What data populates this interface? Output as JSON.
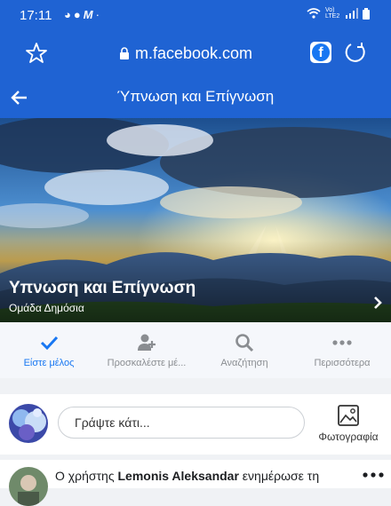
{
  "status_bar": {
    "time": "17:11",
    "notification_icons": [
      "messenger-icon",
      "facebook-icon",
      "m-app-icon",
      "dot-icon"
    ],
    "right_icons": [
      "wifi-icon",
      "volte-lte2-icon",
      "signal-icon",
      "battery-icon"
    ],
    "network_label": "Vo) LTE2"
  },
  "browser": {
    "url": "m.facebook.com",
    "fb_badge": "f"
  },
  "header": {
    "title": "Ύπνωση και Επίγνωση"
  },
  "cover": {
    "group_name": "Υπνωση και Επίγνωση",
    "group_type": "Ομάδα Δημόσια"
  },
  "actions": [
    {
      "label": "Είστε μέλος",
      "icon": "check-icon",
      "active": true
    },
    {
      "label": "Προσκαλέστε μέ...",
      "icon": "add-person-icon",
      "active": false
    },
    {
      "label": "Αναζήτηση",
      "icon": "search-icon",
      "active": false
    },
    {
      "label": "Περισσότερα",
      "icon": "more-dots-icon",
      "active": false
    }
  ],
  "composer": {
    "placeholder": "Γράψτε κάτι...",
    "photo_label": "Φωτογραφία"
  },
  "post": {
    "prefix": "Ο χρήστης ",
    "author": "Lemonis Aleksandar",
    "action_text": " ενημέρωσε τη"
  },
  "colors": {
    "brand_blue": "#1f63d3",
    "facebook_blue": "#1877f2",
    "muted_gray": "#8a8d91"
  }
}
